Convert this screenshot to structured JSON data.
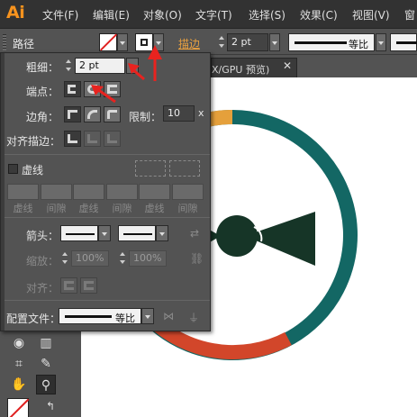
{
  "app": {
    "logo": "Ai"
  },
  "menu": [
    {
      "label": "文件(F)"
    },
    {
      "label": "编辑(E)"
    },
    {
      "label": "对象(O)"
    },
    {
      "label": "文字(T)"
    },
    {
      "label": "选择(S)"
    },
    {
      "label": "效果(C)"
    },
    {
      "label": "视图(V)"
    },
    {
      "label": "窗"
    }
  ],
  "controlbar": {
    "selection_label": "路径",
    "stroke_link_label": "描边",
    "stroke_weight": "2 pt",
    "profile_label": "等比"
  },
  "document": {
    "tab_title": "X/GPU 预览)",
    "close_glyph": "✕"
  },
  "stroke_panel": {
    "weight_label": "粗细：",
    "weight_value": "2 pt",
    "cap_label": "端点：",
    "corner_label": "边角：",
    "limit_label": "限制：",
    "limit_value": "10",
    "limit_unit": "x",
    "align_label": "对齐描边：",
    "dashed_label": "虚线",
    "dash_labels": [
      "虚线",
      "间隙",
      "虚线",
      "间隙",
      "虚线",
      "间隙"
    ],
    "arrowhead_label": "箭头：",
    "scale_label": "缩放：",
    "scale_start": "100%",
    "scale_end": "100%",
    "align_arrow_label": "对齐：",
    "profile_label": "配置文件：",
    "profile_value": "等比"
  },
  "colors": {
    "ring_teal": "#136764",
    "ring_red": "#d2462a",
    "ring_orange": "#e5a03b",
    "bowtie": "#163527",
    "annotation": "#e8231f"
  }
}
